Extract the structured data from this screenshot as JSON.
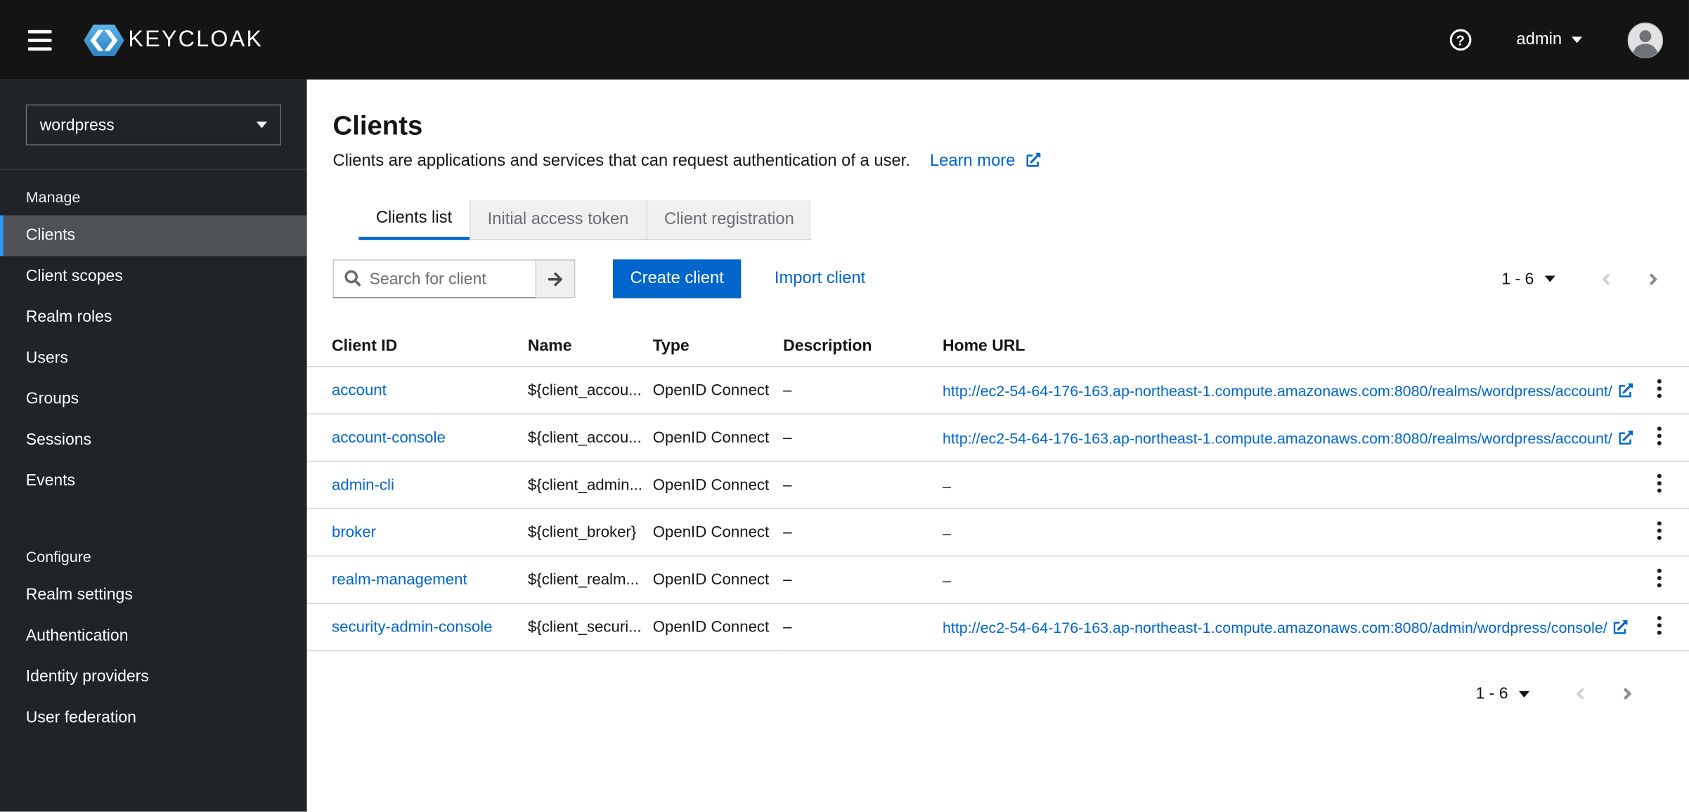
{
  "colors": {
    "accent_blue": "#0066cc",
    "link_blue": "#0066cc",
    "masthead_bg": "#141414",
    "sidebar_bg": "#212427",
    "sidebar_selected_bg": "#4f5255",
    "selected_indicator_blue": "#2b9af3",
    "tab_inactive_bg": "#f0f0f0",
    "table_border": "#d2d2d2"
  },
  "icons": {
    "menu_icon": "≡",
    "help_icon": "?",
    "caret_down_icon": "▾",
    "search_icon": "⌕",
    "arrow_right_icon": "→",
    "external_link_icon": "↗",
    "kebab_icon": "⋮",
    "angle_left_icon": "‹",
    "angle_right_icon": "›",
    "user_icon": "👤"
  },
  "masthead": {
    "brand": "KEYCLOAK",
    "username": "admin"
  },
  "sidebar": {
    "realm_selector": "wordpress",
    "sections": [
      {
        "label": "Manage",
        "items": [
          {
            "label": "Clients",
            "active": true
          },
          {
            "label": "Client scopes",
            "active": false
          },
          {
            "label": "Realm roles",
            "active": false
          },
          {
            "label": "Users",
            "active": false
          },
          {
            "label": "Groups",
            "active": false
          },
          {
            "label": "Sessions",
            "active": false
          },
          {
            "label": "Events",
            "active": false
          }
        ]
      },
      {
        "label": "Configure",
        "items": [
          {
            "label": "Realm settings",
            "active": false
          },
          {
            "label": "Authentication",
            "active": false
          },
          {
            "label": "Identity providers",
            "active": false
          },
          {
            "label": "User federation",
            "active": false
          }
        ]
      }
    ]
  },
  "page": {
    "title": "Clients",
    "description": "Clients are applications and services that can request authentication of a user.",
    "learn_more_label": "Learn more",
    "tabs": [
      {
        "label": "Clients list",
        "active": true
      },
      {
        "label": "Initial access token",
        "active": false
      },
      {
        "label": "Client registration",
        "active": false
      }
    ],
    "toolbar": {
      "search_placeholder": "Search for client",
      "create_button_label": "Create client",
      "import_link_label": "Import client"
    },
    "pagination": {
      "range": "1 - 6"
    },
    "table": {
      "columns": [
        "Client ID",
        "Name",
        "Type",
        "Description",
        "Home URL"
      ],
      "rows": [
        {
          "client_id": "account",
          "name": "${client_accou...",
          "type": "OpenID Connect",
          "description": "–",
          "home_url": "http://ec2-54-64-176-163.ap-northeast-1.compute.amazonaws.com:8080/realms/wordpress/account/",
          "home_url_external": true
        },
        {
          "client_id": "account-console",
          "name": "${client_accou...",
          "type": "OpenID Connect",
          "description": "–",
          "home_url": "http://ec2-54-64-176-163.ap-northeast-1.compute.amazonaws.com:8080/realms/wordpress/account/",
          "home_url_external": true
        },
        {
          "client_id": "admin-cli",
          "name": "${client_admin...",
          "type": "OpenID Connect",
          "description": "–",
          "home_url": "–",
          "home_url_external": false
        },
        {
          "client_id": "broker",
          "name": "${client_broker}",
          "type": "OpenID Connect",
          "description": "–",
          "home_url": "–",
          "home_url_external": false
        },
        {
          "client_id": "realm-management",
          "name": "${client_realm...",
          "type": "OpenID Connect",
          "description": "–",
          "home_url": "–",
          "home_url_external": false
        },
        {
          "client_id": "security-admin-console",
          "name": "${client_securi...",
          "type": "OpenID Connect",
          "description": "–",
          "home_url": "http://ec2-54-64-176-163.ap-northeast-1.compute.amazonaws.com:8080/admin/wordpress/console/",
          "home_url_external": true
        }
      ]
    }
  }
}
